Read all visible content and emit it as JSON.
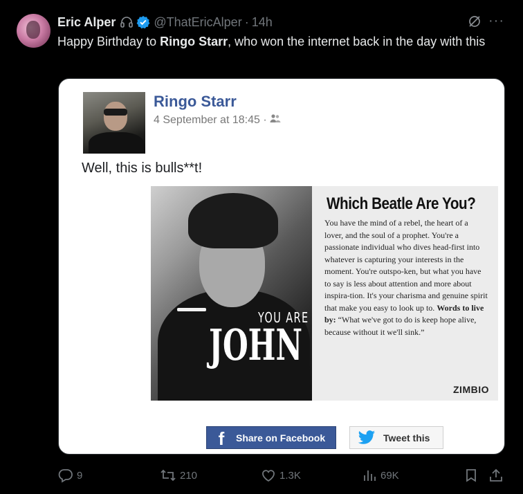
{
  "author": {
    "name": "Eric Alper",
    "handle": "@ThatEricAlper",
    "separator": "·",
    "time": "14h"
  },
  "tweet": {
    "text_pre": "Happy Birthday to ",
    "text_bold": "Ringo Starr",
    "text_post": ", who won the internet back in the day with this"
  },
  "embedded_post": {
    "name": "Ringo Starr",
    "date": "4 September at 18:45 ·",
    "status": "Well, this is bulls**t!",
    "quiz": {
      "photo_line1": "YOU ARE",
      "photo_line2": "JOHN",
      "title": "Which Beatle Are You?",
      "body": "You have the mind of a rebel, the heart of a lover, and the soul of a prophet. You're a passionate individual who dives head-first into whatever is capturing your interests in the moment. You're outspo-ken, but what you have to say is less about attention and more about inspira-tion. It's your charisma and genuine spirit that make you easy to look up to.",
      "words_label": "Words to live by:",
      "words_text": " “What we've got to do is keep hope alive, because without it we'll sink.”",
      "brand": "ZIMBIO"
    },
    "share_facebook": "Share on Facebook",
    "tweet_this": "Tweet this"
  },
  "actions": {
    "replies": "9",
    "reposts": "210",
    "likes": "1.3K",
    "views": "69K"
  },
  "icons": [
    "headphones-icon",
    "verified-icon",
    "grok-icon",
    "more-icon",
    "friends-icon",
    "facebook-icon",
    "twitter-bird-icon",
    "reply-icon",
    "repost-icon",
    "like-icon",
    "views-icon",
    "bookmark-icon",
    "share-icon"
  ],
  "colors": {
    "verified": "#1d9bf0",
    "facebook": "#3b5998",
    "twitter": "#1da1f2",
    "muted": "#71767b"
  }
}
